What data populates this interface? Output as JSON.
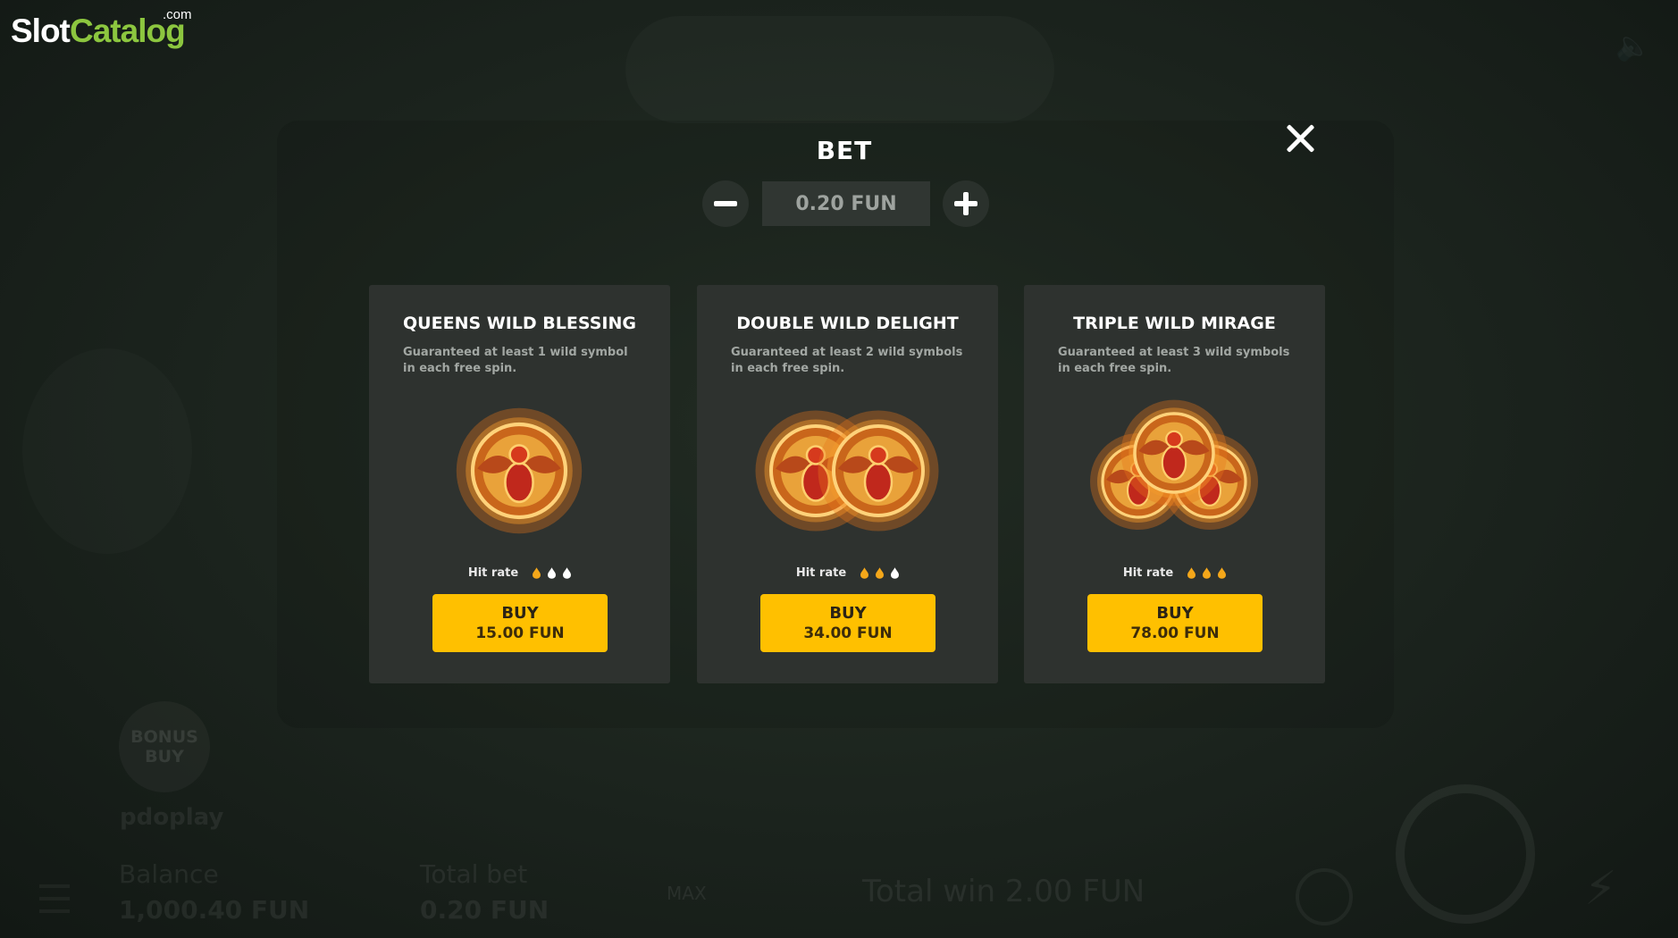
{
  "logo": {
    "part1": "Slot",
    "part2": "Catalog",
    "suffix": ".com"
  },
  "background": {
    "bonus_buy": [
      "BONUS",
      "BUY"
    ],
    "brand": "pdoplay",
    "balance_label": "Balance",
    "balance_value": "1,000.40 FUN",
    "total_bet_label": "Total bet",
    "total_bet_value": "0.20 FUN",
    "max_label": "MAX",
    "total_win": "Total win 2.00 FUN"
  },
  "bet": {
    "title": "BET",
    "value": "0.20 FUN"
  },
  "cards": [
    {
      "title": "QUEENS WILD BLESSING",
      "description": "Guaranteed at least 1 wild symbol in each free spin.",
      "hit_rate_label": "Hit rate",
      "hit_rate_filled": 1,
      "hit_rate_max": 3,
      "buy_label": "BUY",
      "price": "15.00 FUN"
    },
    {
      "title": "DOUBLE WILD DELIGHT",
      "description": "Guaranteed at least 2 wild symbols in each free spin.",
      "hit_rate_label": "Hit rate",
      "hit_rate_filled": 2,
      "hit_rate_max": 3,
      "buy_label": "BUY",
      "price": "34.00 FUN"
    },
    {
      "title": "TRIPLE WILD MIRAGE",
      "description": "Guaranteed at least 3 wild symbols in each free spin.",
      "hit_rate_label": "Hit rate",
      "hit_rate_filled": 3,
      "hit_rate_max": 3,
      "buy_label": "BUY",
      "price": "78.00 FUN"
    }
  ],
  "colors": {
    "accent": "#ffc000",
    "drop_filled": "#f4a71a",
    "drop_empty": "#ffffff",
    "logo_green": "#8cc63f"
  },
  "icons": {
    "close": "close-icon",
    "minus": "minus-icon",
    "plus": "plus-icon",
    "drop": "flame-drop-icon",
    "scarab": "scarab-wild-icon"
  }
}
